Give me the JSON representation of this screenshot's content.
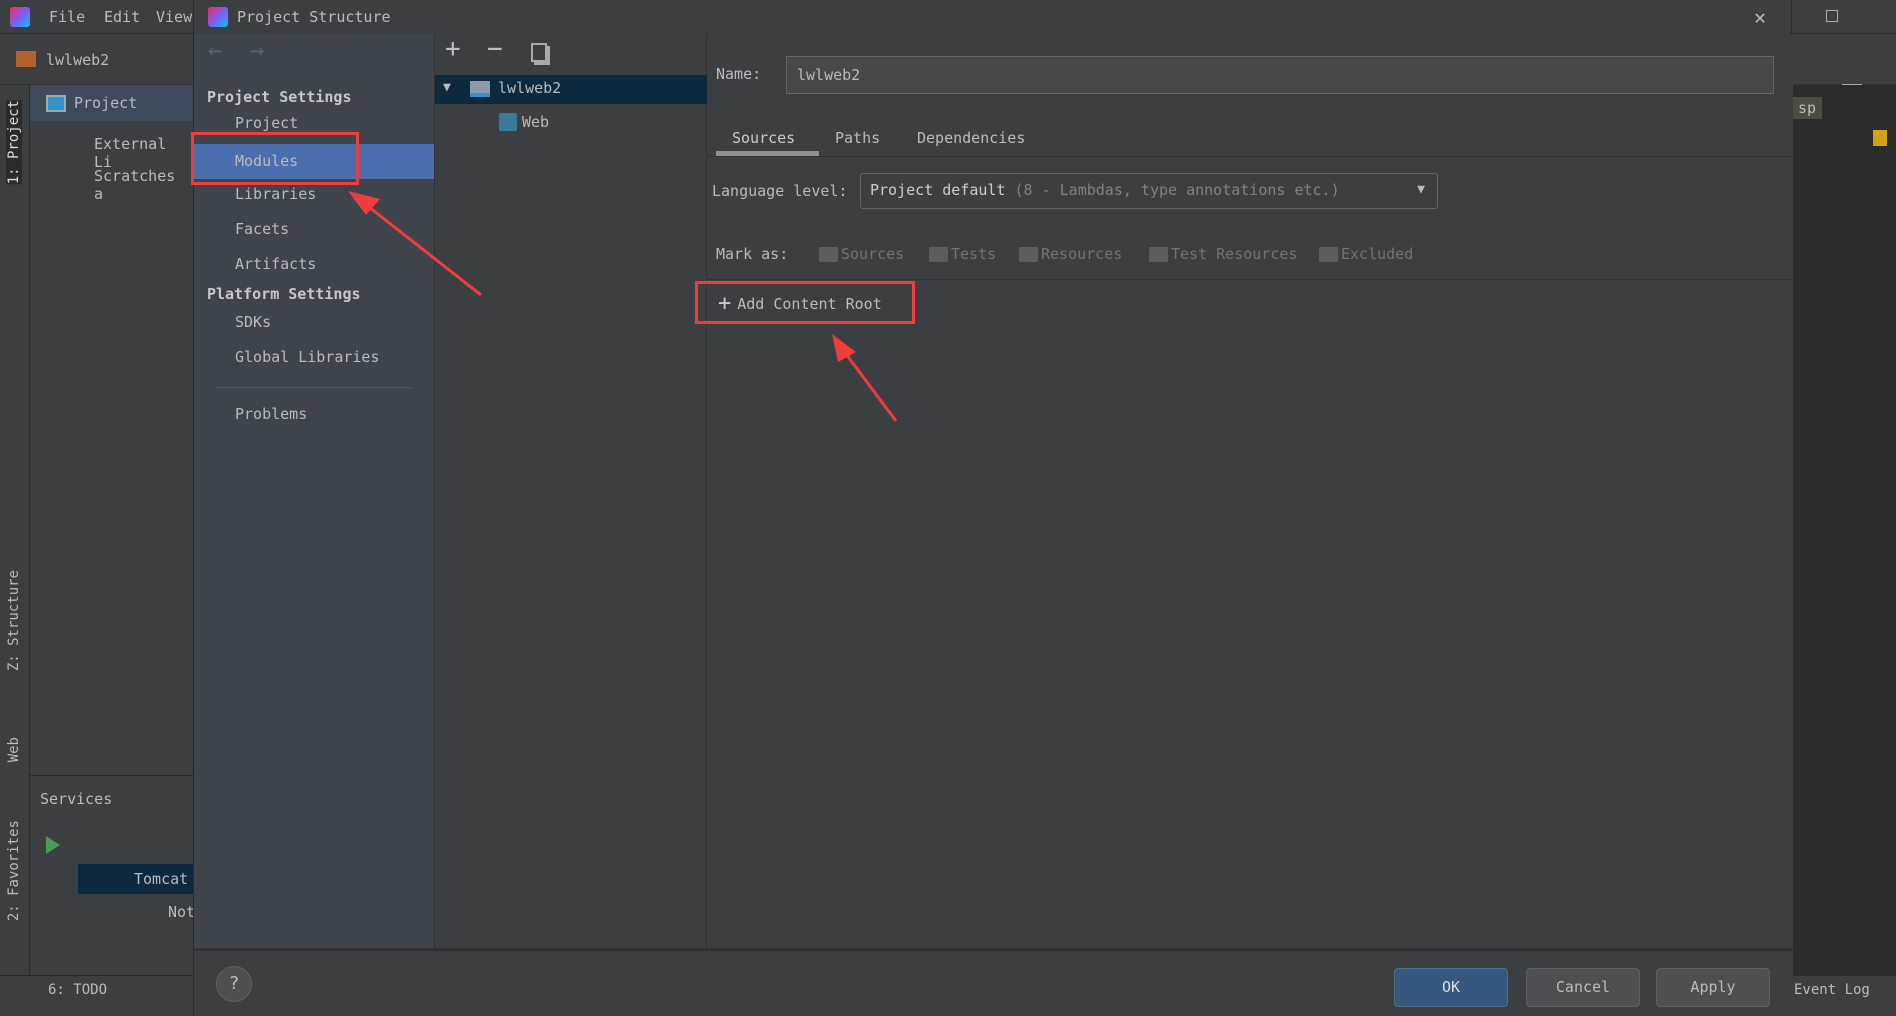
{
  "ide": {
    "menu": [
      "File",
      "Edit",
      "View"
    ],
    "project_name": "lwlweb2",
    "project_panel": {
      "title": "Project",
      "items": [
        "External Li",
        "Scratches a"
      ]
    },
    "left_strip": [
      "1: Project",
      "Z: Structure",
      "Web",
      "2: Favorites"
    ],
    "services": {
      "title": "Services",
      "items": [
        "Tomcat",
        "Not"
      ]
    },
    "bottom": {
      "todo": "6: TODO",
      "event_log": "Event Log"
    },
    "editor_tab": "sp"
  },
  "dialog": {
    "title": "Project Structure",
    "nav": {
      "project_settings": "Project Settings",
      "project_items": [
        "Project",
        "Modules",
        "Libraries",
        "Facets",
        "Artifacts"
      ],
      "platform_settings": "Platform Settings",
      "platform_items": [
        "SDKs",
        "Global Libraries"
      ],
      "problems": "Problems",
      "selected": "Modules"
    },
    "tree": {
      "module": "lwlweb2",
      "facet": "Web"
    },
    "name_label": "Name:",
    "name_value": "lwlweb2",
    "tabs": [
      "Sources",
      "Paths",
      "Dependencies"
    ],
    "active_tab": "Sources",
    "language_label": "Language level:",
    "language_value": "Project default",
    "language_hint": "(8 - Lambdas, type annotations etc.)",
    "mark_as_label": "Mark as:",
    "mark_as": [
      "Sources",
      "Tests",
      "Resources",
      "Test Resources",
      "Excluded"
    ],
    "add_content_root": "Add Content Root",
    "buttons": {
      "ok": "OK",
      "cancel": "Cancel",
      "apply": "Apply",
      "help": "?"
    },
    "annotation_color": "#f03c3c",
    "selection_color": "#4b6eaf"
  }
}
